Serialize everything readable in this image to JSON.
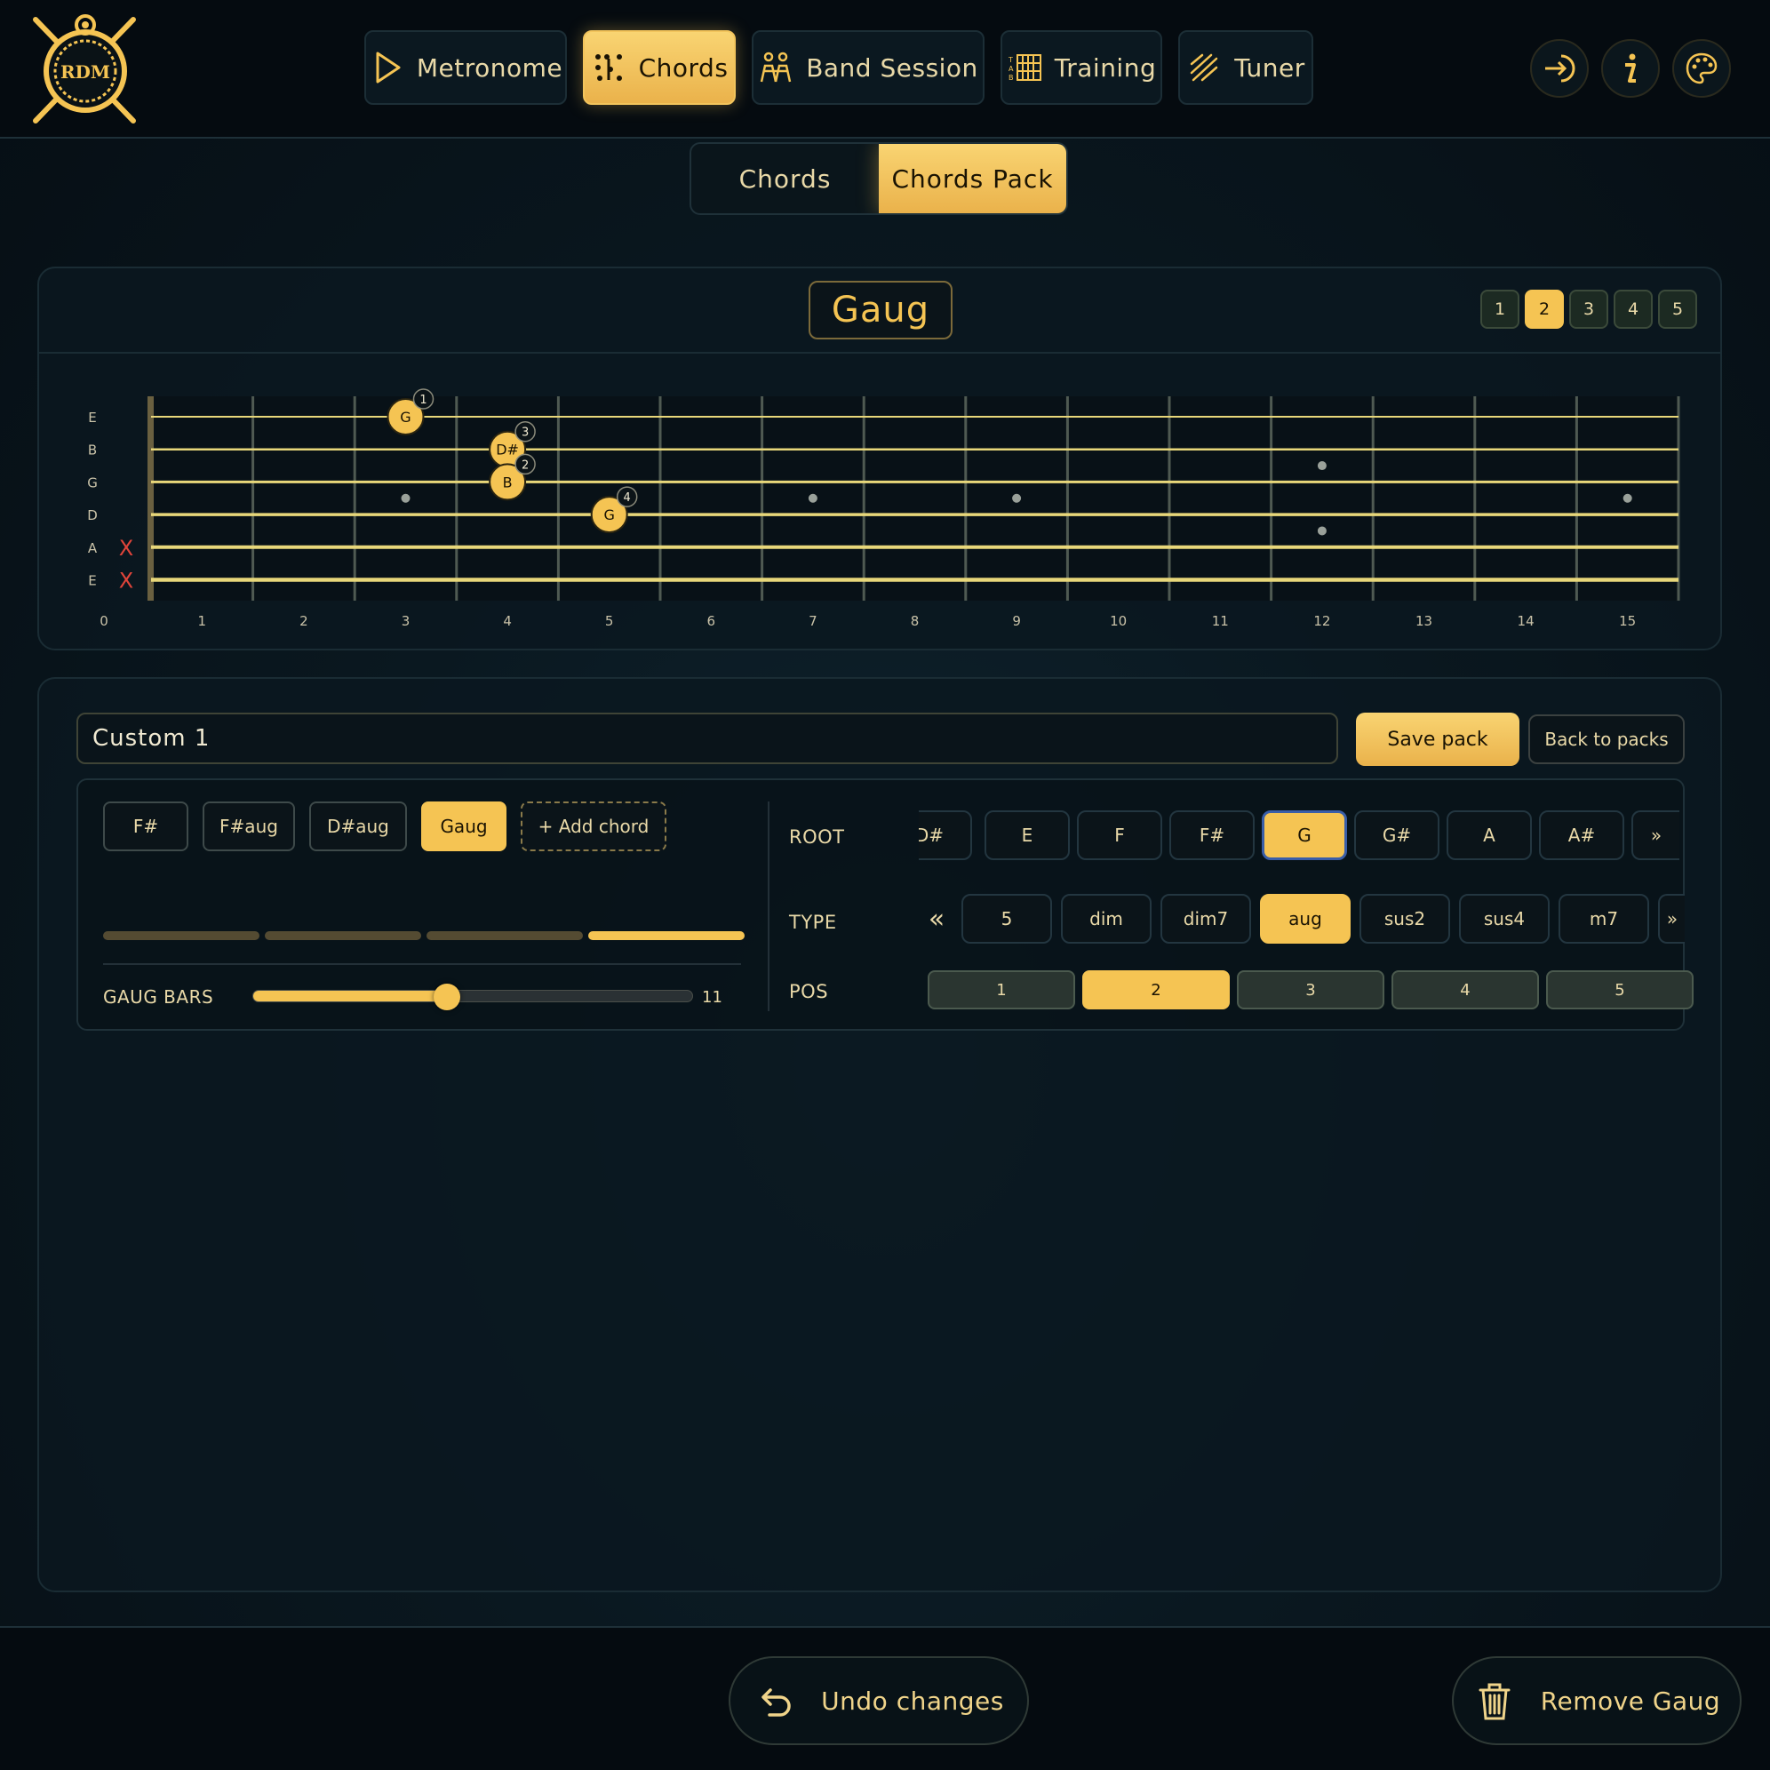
{
  "colors": {
    "accent": "#f5c453",
    "background": "#0a1820",
    "string": "#e8d77a",
    "mute": "#e0443a",
    "highlight_border": "#3a5ea8"
  },
  "logo": {
    "text": "RDM"
  },
  "nav": {
    "items": [
      {
        "label": "Metronome",
        "icon": "play-icon"
      },
      {
        "label": "Chords",
        "icon": "chords-icon"
      },
      {
        "label": "Band Session",
        "icon": "band-icon"
      },
      {
        "label": "Training",
        "icon": "training-icon"
      },
      {
        "label": "Tuner",
        "icon": "tuner-icon"
      }
    ],
    "active": "Chords",
    "right_icons": [
      "login-icon",
      "info-icon",
      "palette-icon"
    ]
  },
  "subtabs": {
    "items": [
      "Chords",
      "Chords Pack"
    ],
    "active": "Chords Pack"
  },
  "fretboard": {
    "chord_name": "Gaug",
    "positions": [
      "1",
      "2",
      "3",
      "4",
      "5"
    ],
    "active_position": "2",
    "strings": [
      "E",
      "B",
      "G",
      "D",
      "A",
      "E"
    ],
    "fret_numbers": [
      "0",
      "1",
      "2",
      "3",
      "4",
      "5",
      "6",
      "7",
      "8",
      "9",
      "10",
      "11",
      "12",
      "13",
      "14",
      "15"
    ],
    "muted_strings": [
      "A",
      "E"
    ],
    "mute_symbol": "X",
    "notes": [
      {
        "string": 0,
        "fret": 3,
        "note": "G",
        "finger": "1"
      },
      {
        "string": 1,
        "fret": 4,
        "note": "D#",
        "finger": "3"
      },
      {
        "string": 2,
        "fret": 4,
        "note": "B",
        "finger": "2"
      },
      {
        "string": 3,
        "fret": 5,
        "note": "G",
        "finger": "4"
      }
    ],
    "inlay_frets": [
      3,
      5,
      7,
      9,
      12,
      15
    ]
  },
  "editor": {
    "pack_name": "Custom 1",
    "save_label": "Save pack",
    "back_label": "Back to packs",
    "chords": [
      "F#",
      "F#aug",
      "D#aug",
      "Gaug"
    ],
    "active_chord": "Gaug",
    "add_chord_label": "+ Add chord",
    "bars_label": "GAUG BARS",
    "bars_value": "11",
    "bars_fraction": 0.44,
    "root_label": "ROOT",
    "roots": [
      "D#",
      "E",
      "F",
      "F#",
      "G",
      "G#",
      "A",
      "A#"
    ],
    "active_root": "G",
    "type_label": "TYPE",
    "types": [
      "5",
      "dim",
      "dim7",
      "aug",
      "sus2",
      "sus4",
      "m7"
    ],
    "active_type": "aug",
    "pos_label": "POS",
    "positions": [
      "1",
      "2",
      "3",
      "4",
      "5"
    ],
    "active_position": "2",
    "next_symbol": "»",
    "prev_symbol": "«"
  },
  "footer": {
    "undo_label": "Undo changes",
    "remove_label": "Remove Gaug"
  }
}
